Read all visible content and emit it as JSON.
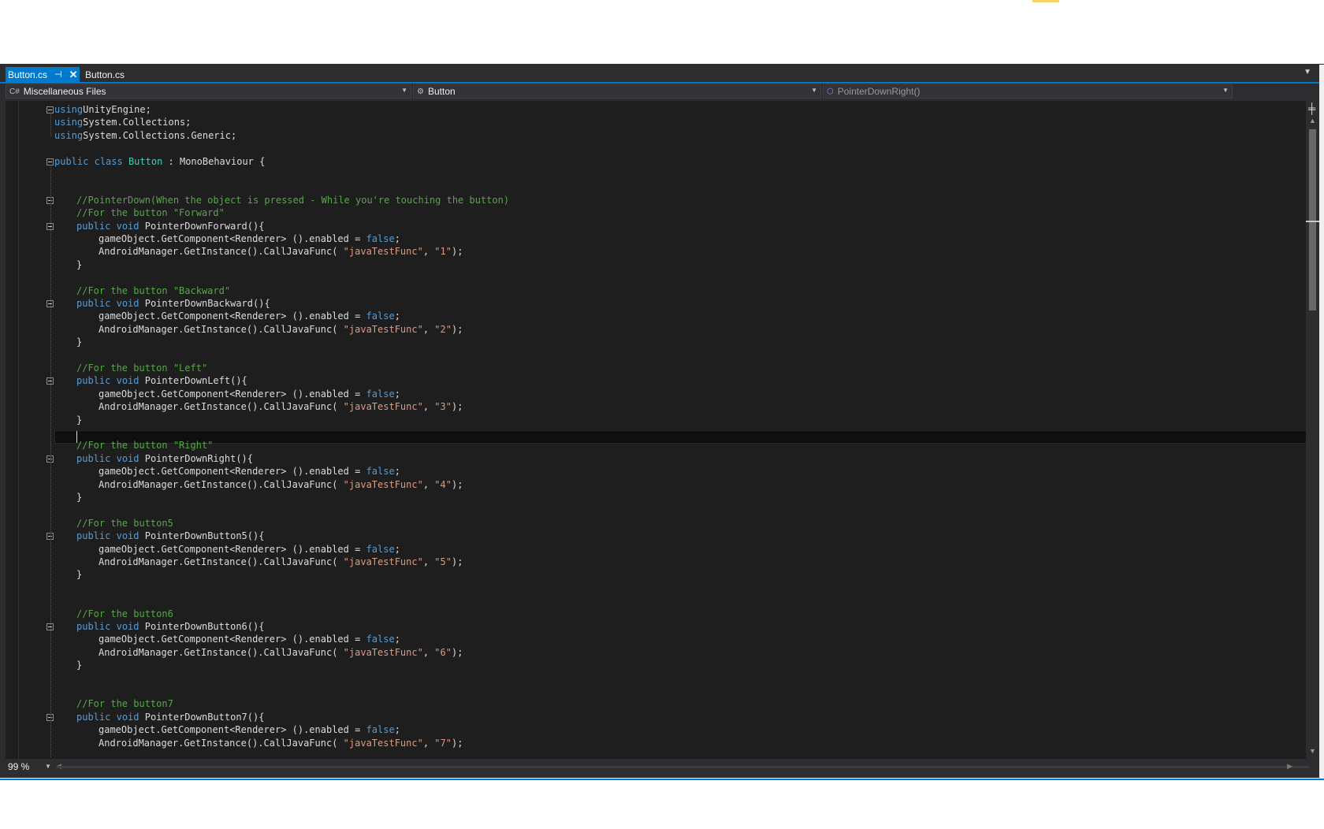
{
  "tabs": [
    {
      "label": "Button.cs",
      "active": true
    },
    {
      "label": "Button.cs",
      "active": false
    }
  ],
  "navigation": {
    "project": "Miscellaneous Files",
    "type": "Button",
    "member": "PointerDownRight()"
  },
  "zoom": "99 %",
  "code_lines": [
    {
      "row": 0,
      "fold": true,
      "indent": 0,
      "tokens": [
        [
          "kw",
          "using"
        ],
        [
          "",
          "UnityEngine;"
        ]
      ]
    },
    {
      "row": 1,
      "indent": 0,
      "tokens": [
        [
          "kw",
          "using"
        ],
        [
          "",
          "System.Collections;"
        ]
      ]
    },
    {
      "row": 2,
      "indent": 0,
      "tokens": [
        [
          "kw",
          "using"
        ],
        [
          "",
          "System.Collections.Generic;"
        ]
      ]
    },
    {
      "row": 4,
      "fold": true,
      "indent": 0,
      "tokens": [
        [
          "kw",
          "public"
        ],
        [
          "",
          " "
        ],
        [
          "kw",
          "class"
        ],
        [
          "",
          " "
        ],
        [
          "ty",
          "Button"
        ],
        [
          "",
          " : MonoBehaviour {"
        ]
      ]
    },
    {
      "row": 7,
      "fold": true,
      "indent": 1,
      "tokens": [
        [
          "cm",
          "//PointerDown(When the object is pressed - While you're touching the button)"
        ]
      ]
    },
    {
      "row": 8,
      "indent": 1,
      "tokens": [
        [
          "cm",
          "//For the button \"Forward\""
        ]
      ]
    },
    {
      "row": 9,
      "fold": true,
      "indent": 1,
      "tokens": [
        [
          "kw",
          "public"
        ],
        [
          "",
          " "
        ],
        [
          "kw",
          "void"
        ],
        [
          "",
          " PointerDownForward(){"
        ]
      ]
    },
    {
      "row": 10,
      "indent": 2,
      "tokens": [
        [
          "",
          "gameObject.GetComponent<Renderer> ().enabled = "
        ],
        [
          "kw",
          "false"
        ],
        [
          "",
          ";"
        ]
      ]
    },
    {
      "row": 11,
      "indent": 2,
      "tokens": [
        [
          "",
          "AndroidManager.GetInstance().CallJavaFunc( "
        ],
        [
          "str",
          "\"javaTestFunc\""
        ],
        [
          "",
          ", "
        ],
        [
          "str",
          "\"1\""
        ],
        [
          "",
          ");"
        ]
      ]
    },
    {
      "row": 12,
      "indent": 1,
      "tokens": [
        [
          "",
          "}"
        ]
      ]
    },
    {
      "row": 14,
      "indent": 1,
      "tokens": [
        [
          "cm",
          "//For the button \"Backward\""
        ]
      ]
    },
    {
      "row": 15,
      "fold": true,
      "indent": 1,
      "tokens": [
        [
          "kw",
          "public"
        ],
        [
          "",
          " "
        ],
        [
          "kw",
          "void"
        ],
        [
          "",
          " PointerDownBackward(){"
        ]
      ]
    },
    {
      "row": 16,
      "indent": 2,
      "tokens": [
        [
          "",
          "gameObject.GetComponent<Renderer> ().enabled = "
        ],
        [
          "kw",
          "false"
        ],
        [
          "",
          ";"
        ]
      ]
    },
    {
      "row": 17,
      "indent": 2,
      "tokens": [
        [
          "",
          "AndroidManager.GetInstance().CallJavaFunc( "
        ],
        [
          "str",
          "\"javaTestFunc\""
        ],
        [
          "",
          ", "
        ],
        [
          "str",
          "\"2\""
        ],
        [
          "",
          ");"
        ]
      ]
    },
    {
      "row": 18,
      "indent": 1,
      "tokens": [
        [
          "",
          "}"
        ]
      ]
    },
    {
      "row": 20,
      "indent": 1,
      "tokens": [
        [
          "cm",
          "//For the button \"Left\""
        ]
      ]
    },
    {
      "row": 21,
      "fold": true,
      "indent": 1,
      "tokens": [
        [
          "kw",
          "public"
        ],
        [
          "",
          " "
        ],
        [
          "kw",
          "void"
        ],
        [
          "",
          " PointerDownLeft(){"
        ]
      ]
    },
    {
      "row": 22,
      "indent": 2,
      "tokens": [
        [
          "",
          "gameObject.GetComponent<Renderer> ().enabled = "
        ],
        [
          "kw",
          "false"
        ],
        [
          "",
          ";"
        ]
      ]
    },
    {
      "row": 23,
      "indent": 2,
      "tokens": [
        [
          "",
          "AndroidManager.GetInstance().CallJavaFunc( "
        ],
        [
          "str",
          "\"javaTestFunc\""
        ],
        [
          "",
          ", "
        ],
        [
          "str",
          "\"3\""
        ],
        [
          "",
          ");"
        ]
      ]
    },
    {
      "row": 24,
      "indent": 1,
      "tokens": [
        [
          "",
          "}"
        ]
      ]
    },
    {
      "row": 26,
      "indent": 1,
      "tokens": [
        [
          "cm",
          "//For the button \"Right\""
        ]
      ]
    },
    {
      "row": 27,
      "fold": true,
      "indent": 1,
      "tokens": [
        [
          "kw",
          "public"
        ],
        [
          "",
          " "
        ],
        [
          "kw",
          "void"
        ],
        [
          "",
          " PointerDownRight(){"
        ]
      ]
    },
    {
      "row": 28,
      "indent": 2,
      "tokens": [
        [
          "",
          "gameObject.GetComponent<Renderer> ().enabled = "
        ],
        [
          "kw",
          "false"
        ],
        [
          "",
          ";"
        ]
      ]
    },
    {
      "row": 29,
      "indent": 2,
      "tokens": [
        [
          "",
          "AndroidManager.GetInstance().CallJavaFunc( "
        ],
        [
          "str",
          "\"javaTestFunc\""
        ],
        [
          "",
          ", "
        ],
        [
          "str",
          "\"4\""
        ],
        [
          "",
          ");"
        ]
      ]
    },
    {
      "row": 30,
      "indent": 1,
      "tokens": [
        [
          "",
          "}"
        ]
      ]
    },
    {
      "row": 32,
      "indent": 1,
      "tokens": [
        [
          "cm",
          "//For the button5"
        ]
      ]
    },
    {
      "row": 33,
      "fold": true,
      "indent": 1,
      "tokens": [
        [
          "kw",
          "public"
        ],
        [
          "",
          " "
        ],
        [
          "kw",
          "void"
        ],
        [
          "",
          " PointerDownButton5(){"
        ]
      ]
    },
    {
      "row": 34,
      "indent": 2,
      "tokens": [
        [
          "",
          "gameObject.GetComponent<Renderer> ().enabled = "
        ],
        [
          "kw",
          "false"
        ],
        [
          "",
          ";"
        ]
      ]
    },
    {
      "row": 35,
      "indent": 2,
      "tokens": [
        [
          "",
          "AndroidManager.GetInstance().CallJavaFunc( "
        ],
        [
          "str",
          "\"javaTestFunc\""
        ],
        [
          "",
          ", "
        ],
        [
          "str",
          "\"5\""
        ],
        [
          "",
          ");"
        ]
      ]
    },
    {
      "row": 36,
      "indent": 1,
      "tokens": [
        [
          "",
          "}"
        ]
      ]
    },
    {
      "row": 39,
      "indent": 1,
      "tokens": [
        [
          "cm",
          "//For the button6"
        ]
      ]
    },
    {
      "row": 40,
      "fold": true,
      "indent": 1,
      "tokens": [
        [
          "kw",
          "public"
        ],
        [
          "",
          " "
        ],
        [
          "kw",
          "void"
        ],
        [
          "",
          " PointerDownButton6(){"
        ]
      ]
    },
    {
      "row": 41,
      "indent": 2,
      "tokens": [
        [
          "",
          "gameObject.GetComponent<Renderer> ().enabled = "
        ],
        [
          "kw",
          "false"
        ],
        [
          "",
          ";"
        ]
      ]
    },
    {
      "row": 42,
      "indent": 2,
      "tokens": [
        [
          "",
          "AndroidManager.GetInstance().CallJavaFunc( "
        ],
        [
          "str",
          "\"javaTestFunc\""
        ],
        [
          "",
          ", "
        ],
        [
          "str",
          "\"6\""
        ],
        [
          "",
          ");"
        ]
      ]
    },
    {
      "row": 43,
      "indent": 1,
      "tokens": [
        [
          "",
          "}"
        ]
      ]
    },
    {
      "row": 46,
      "indent": 1,
      "tokens": [
        [
          "cm",
          "//For the button7"
        ]
      ]
    },
    {
      "row": 47,
      "fold": true,
      "indent": 1,
      "tokens": [
        [
          "kw",
          "public"
        ],
        [
          "",
          " "
        ],
        [
          "kw",
          "void"
        ],
        [
          "",
          " PointerDownButton7(){"
        ]
      ]
    },
    {
      "row": 48,
      "indent": 2,
      "tokens": [
        [
          "",
          "gameObject.GetComponent<Renderer> ().enabled = "
        ],
        [
          "kw",
          "false"
        ],
        [
          "",
          ";"
        ]
      ]
    },
    {
      "row": 49,
      "indent": 2,
      "tokens": [
        [
          "",
          "AndroidManager.GetInstance().CallJavaFunc( "
        ],
        [
          "str",
          "\"javaTestFunc\""
        ],
        [
          "",
          ", "
        ],
        [
          "str",
          "\"7\""
        ],
        [
          "",
          ");"
        ]
      ]
    }
  ]
}
